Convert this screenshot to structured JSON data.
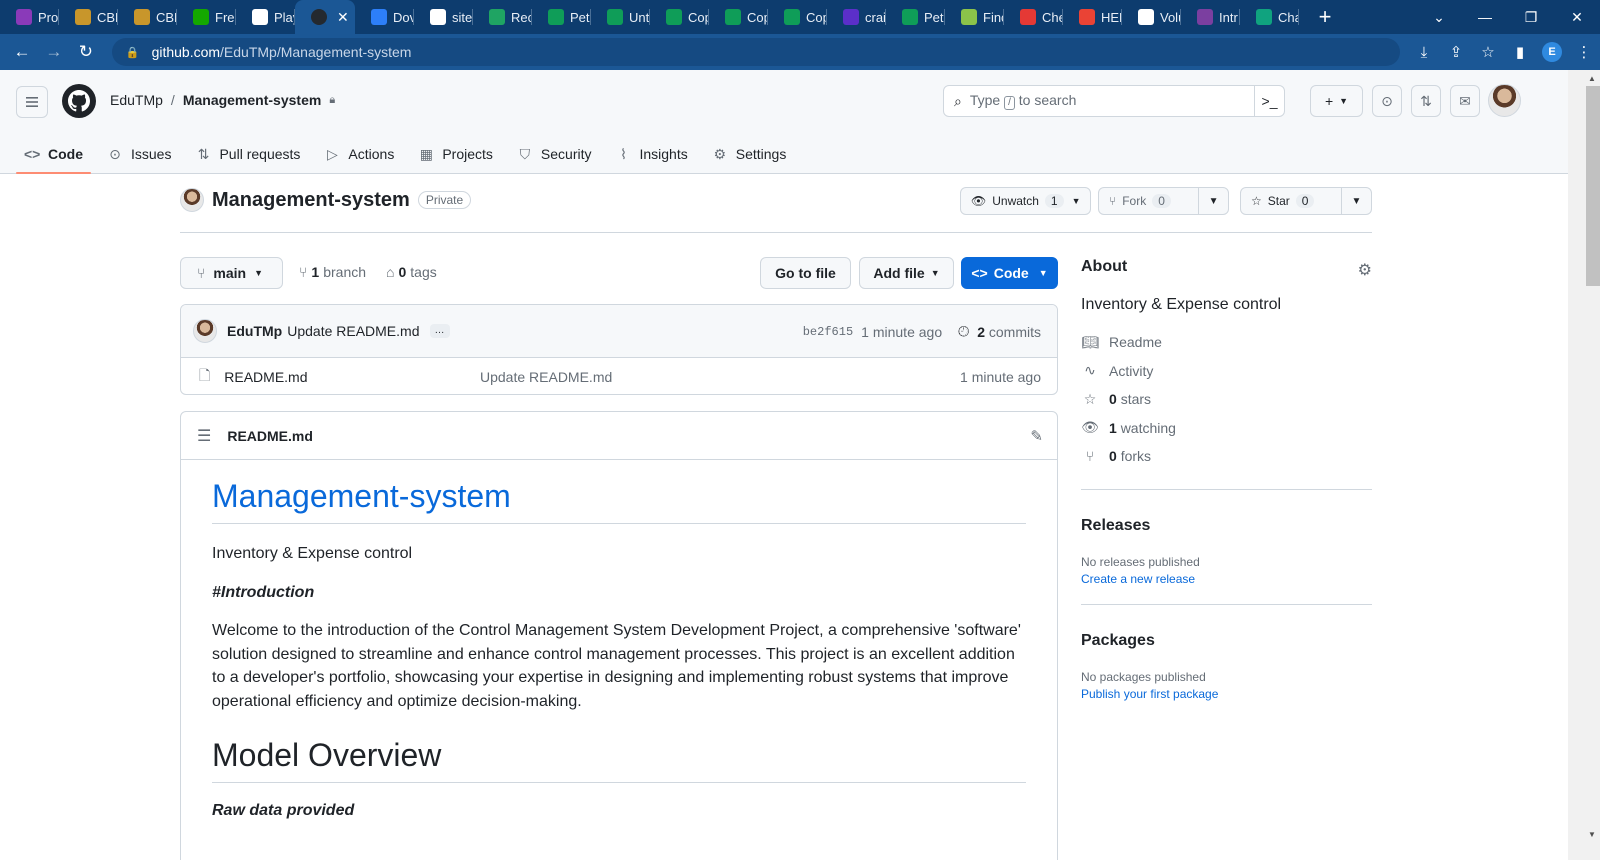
{
  "browser": {
    "tabs": [
      {
        "label": "Prof",
        "color": "#8a3ab9"
      },
      {
        "label": "CBK",
        "color": "#c8962b"
      },
      {
        "label": "CBK",
        "color": "#c8962b"
      },
      {
        "label": "Free",
        "color": "#14a800"
      },
      {
        "label": "Play",
        "color": "#ffffff"
      },
      {
        "label": "",
        "color": "#24292f",
        "active": true
      },
      {
        "label": "Dov",
        "color": "#2d7ff9"
      },
      {
        "label": "site",
        "color": "#ffffff"
      },
      {
        "label": "Rec",
        "color": "#1fa463"
      },
      {
        "label": "Petr",
        "color": "#0f9d58"
      },
      {
        "label": "Unt",
        "color": "#0f9d58"
      },
      {
        "label": "Cop",
        "color": "#0f9d58"
      },
      {
        "label": "Cop",
        "color": "#0f9d58"
      },
      {
        "label": "Cop",
        "color": "#0f9d58"
      },
      {
        "label": "crai",
        "color": "#5b2fc9"
      },
      {
        "label": "Petr",
        "color": "#0f9d58"
      },
      {
        "label": "Finc",
        "color": "#8bc34a"
      },
      {
        "label": "Che",
        "color": "#e53935"
      },
      {
        "label": "HEL",
        "color": "#ea4335"
      },
      {
        "label": "Volu",
        "color": "#ffffff"
      },
      {
        "label": "Intr",
        "color": "#7b3fa0"
      },
      {
        "label": "Cha",
        "color": "#10a37f"
      }
    ],
    "url_host": "github.com",
    "url_path": "/EduTMp/Management-system",
    "profile_letter": "E"
  },
  "header": {
    "owner": "EduTMp",
    "repo": "Management-system",
    "search_prefix": "Type",
    "search_key": "/",
    "search_suffix": "to search"
  },
  "nav": {
    "items": [
      {
        "label": "Code",
        "icon": "code-icon"
      },
      {
        "label": "Issues",
        "icon": "issue-icon"
      },
      {
        "label": "Pull requests",
        "icon": "pull-request-icon"
      },
      {
        "label": "Actions",
        "icon": "play-icon"
      },
      {
        "label": "Projects",
        "icon": "table-icon"
      },
      {
        "label": "Security",
        "icon": "shield-icon"
      },
      {
        "label": "Insights",
        "icon": "graph-icon"
      },
      {
        "label": "Settings",
        "icon": "gear-icon"
      }
    ]
  },
  "repo": {
    "name": "Management-system",
    "visibility": "Private",
    "unwatch_label": "Unwatch",
    "watch_count": "1",
    "fork_label": "Fork",
    "fork_count": "0",
    "star_label": "Star",
    "star_count": "0"
  },
  "toolbar": {
    "branch": "main",
    "branch_count": "1",
    "branch_word": "branch",
    "tag_count": "0",
    "tag_word": "tags",
    "go_to_file": "Go to file",
    "add_file": "Add file",
    "code": "Code"
  },
  "commit": {
    "author": "EduTMp",
    "message": "Update README.md",
    "ellipsis": "…",
    "sha": "be2f615",
    "age": "1 minute ago",
    "commit_count": "2",
    "commit_word": "commits"
  },
  "files": [
    {
      "name": "README.md",
      "message": "Update README.md",
      "age": "1 minute ago"
    }
  ],
  "readme": {
    "filename": "README.md",
    "h1": "Management-system",
    "subtitle": "Inventory & Expense control",
    "intro_heading": "#Introduction",
    "intro_text": "Welcome to the introduction of the Control Management System Development Project, a comprehensive 'software' solution designed to streamline and enhance control management processes. This project is an excellent addition to a developer's portfolio, showcasing your expertise in designing and implementing robust systems that improve operational efficiency and optimize decision-making.",
    "h2": "Model Overview",
    "raw_data": "Raw data provided"
  },
  "about": {
    "title": "About",
    "description": "Inventory & Expense control",
    "readme": "Readme",
    "activity": "Activity",
    "stars_count": "0",
    "stars_word": "stars",
    "watching_count": "1",
    "watching_word": "watching",
    "forks_count": "0",
    "forks_word": "forks"
  },
  "releases": {
    "title": "Releases",
    "empty": "No releases published",
    "link": "Create a new release"
  },
  "packages": {
    "title": "Packages",
    "empty": "No packages published",
    "link": "Publish your first package"
  }
}
